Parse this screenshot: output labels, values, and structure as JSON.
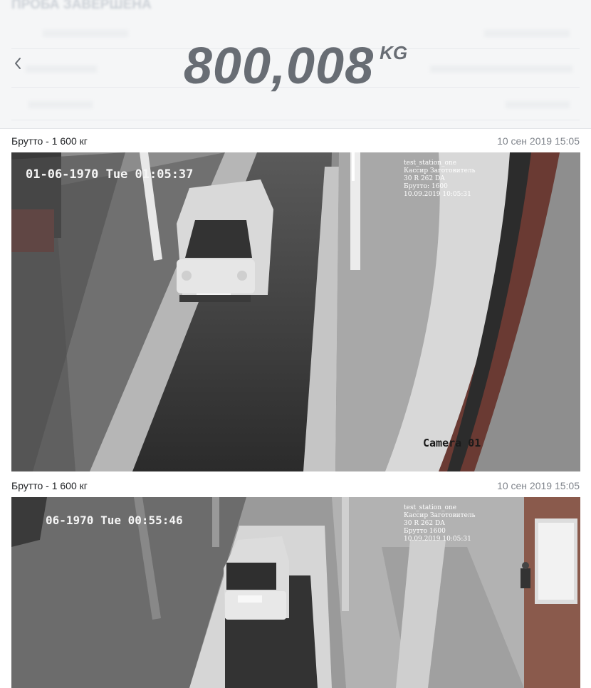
{
  "header": {
    "blurred_title": "ПРОБА ЗАВЕРШЕНА",
    "weight_value": "800,008",
    "weight_unit": "KG"
  },
  "cards": [
    {
      "title": "Брутто - 1 600 кг",
      "date": "10 сен 2019 15:05",
      "osd_timestamp": "01-06-1970 Tue 01:05:37",
      "osd_info": [
        "test_station_one",
        "Кассир Заготовитель",
        "30 R 262 DA",
        "Брутто: 1600",
        "10.09.2019 10:05:31"
      ],
      "camera_label": "Camera 01"
    },
    {
      "title": "Брутто - 1 600 кг",
      "date": "10 сен 2019 15:05",
      "osd_timestamp": "06-1970 Tue 00:55:46",
      "osd_info": [
        "test_station_one",
        "Кассир Заготовитель",
        "30 R 262 DA",
        "Брутто 1600",
        "10.09.2019 10:05:31"
      ]
    }
  ],
  "icons": {
    "back": "chevron-left-icon"
  },
  "colors": {
    "weight": "#686d74",
    "header_bg": "#f5f6f7",
    "date_text": "#80858c"
  }
}
